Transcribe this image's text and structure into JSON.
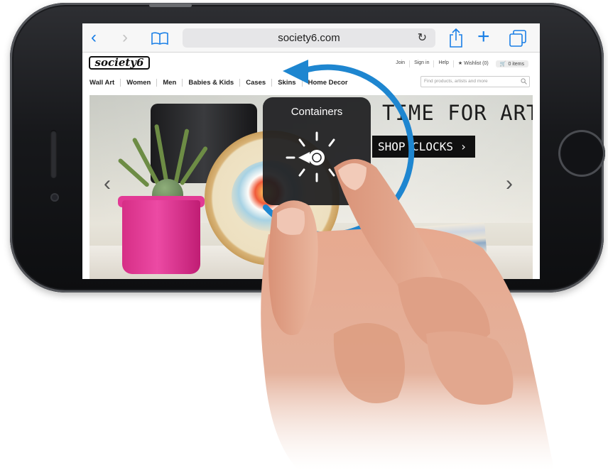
{
  "browser": {
    "url": "society6.com",
    "icons": {
      "back": "chevron-left-icon",
      "forward": "chevron-right-icon",
      "bookmarks": "book-icon",
      "reload": "reload-icon",
      "share": "share-icon",
      "new_tab": "plus-icon",
      "tabs": "tabs-icon"
    },
    "accent_color": "#1a7fe6"
  },
  "site": {
    "logo": "society6",
    "util_links": [
      "Join",
      "Sign in",
      "Help",
      "★ Wishlist (0)",
      "0 items"
    ],
    "nav": [
      "Wall Art",
      "Women",
      "Men",
      "Babies & Kids",
      "Cases",
      "Skins",
      "Home Decor"
    ],
    "search_placeholder": "Find products, artists and more",
    "hero": {
      "title": "TIME FOR ART",
      "cta": "SHOP CLOCKS ›"
    }
  },
  "popup": {
    "title": "Containers",
    "icon": "dial-icon"
  }
}
